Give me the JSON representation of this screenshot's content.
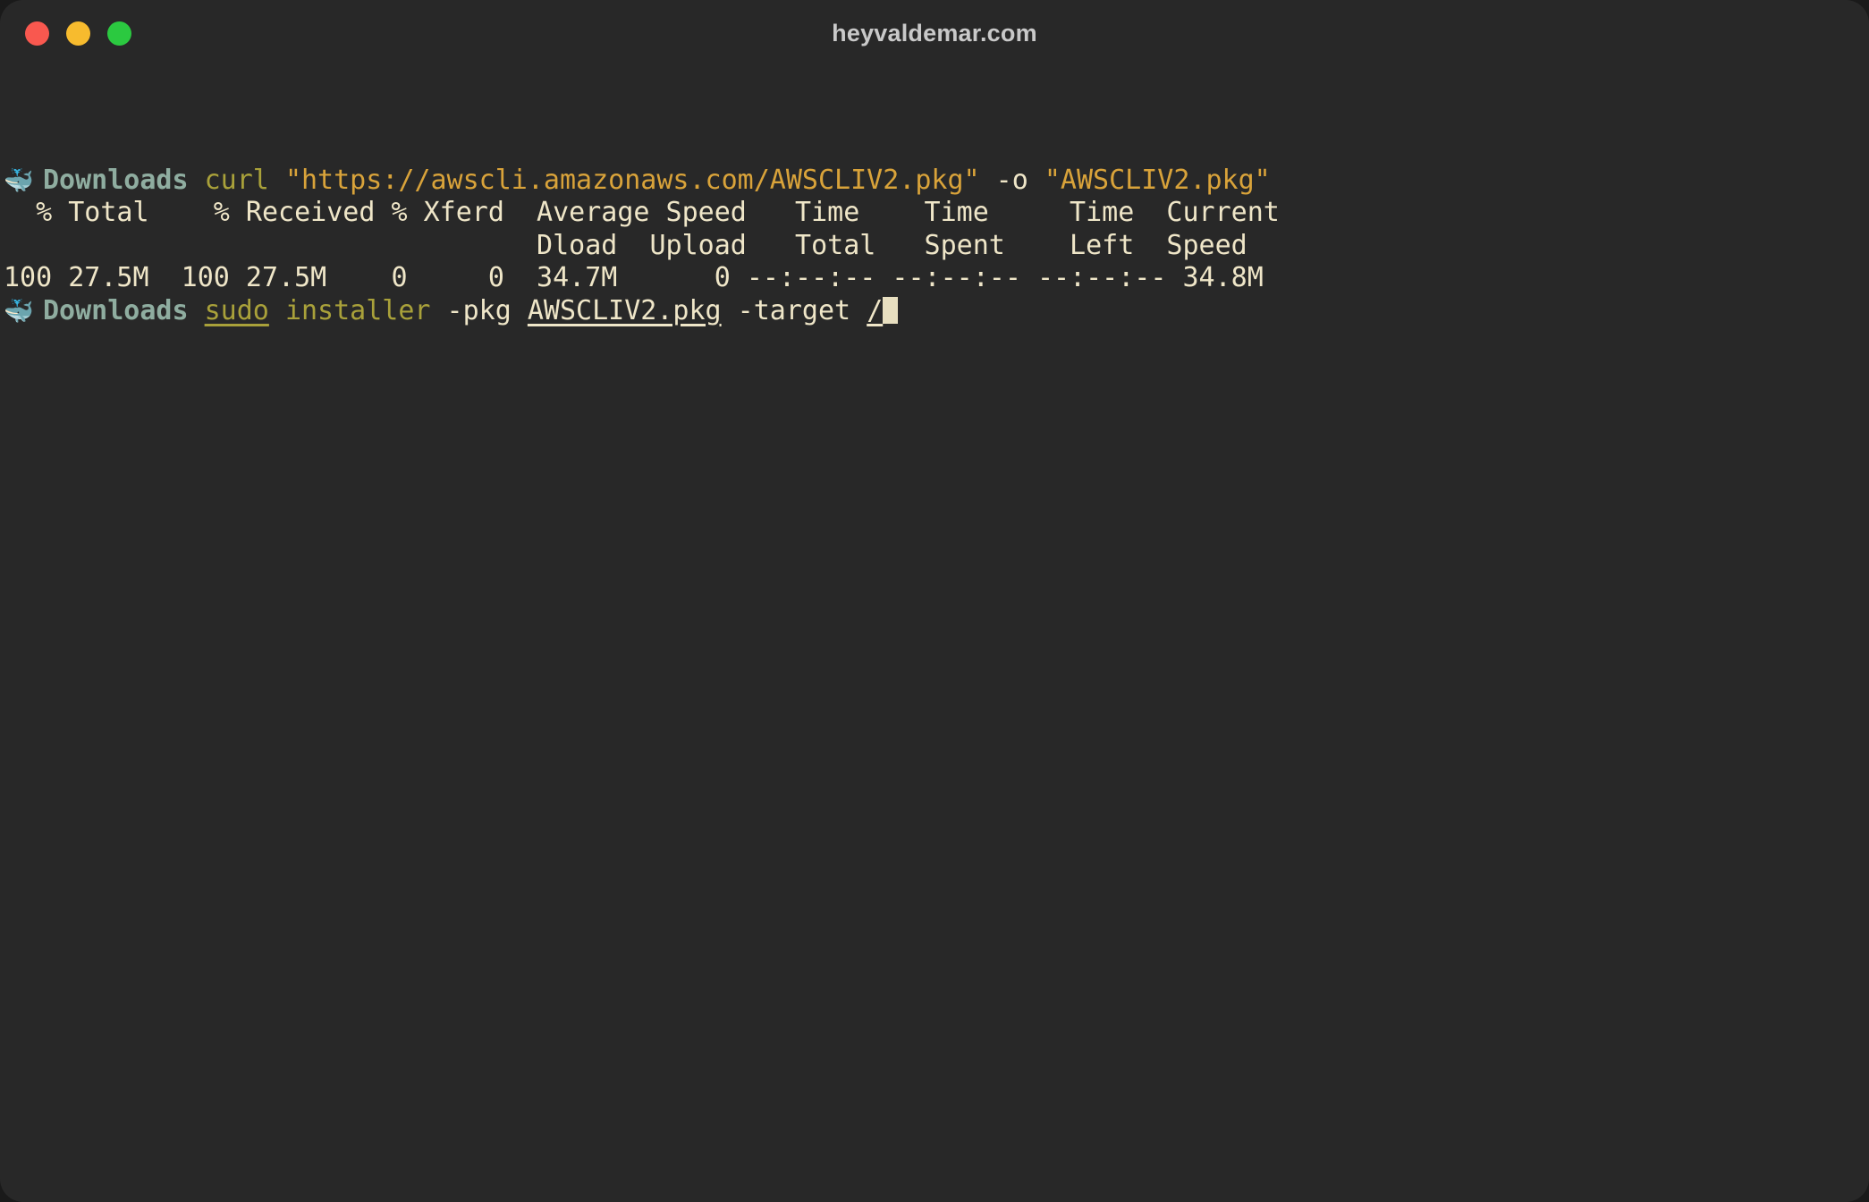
{
  "window": {
    "title": "heyvaldemar.com",
    "background": "#282828",
    "traffic_lights": [
      {
        "name": "close",
        "color": "#f9584f"
      },
      {
        "name": "minimize",
        "color": "#f7bb2e"
      },
      {
        "name": "maximize",
        "color": "#2bc940"
      }
    ]
  },
  "terminal": {
    "prompt_icon": "🐳",
    "prompt_path": "Downloads",
    "lines": [
      {
        "type": "prompt",
        "segments": [
          {
            "text": "curl ",
            "style": "cmd"
          },
          {
            "text": "\"https://awscli.amazonaws.com/AWSCLIV2.pkg\"",
            "style": "string"
          },
          {
            "text": " -o ",
            "style": "plain"
          },
          {
            "text": "\"AWSCLIV2.pkg\"",
            "style": "string"
          }
        ]
      },
      {
        "type": "output",
        "text": "  % Total    % Received % Xferd  Average Speed   Time    Time     Time  Current"
      },
      {
        "type": "output",
        "text": "                                 Dload  Upload   Total   Spent    Left  Speed"
      },
      {
        "type": "output",
        "text": "100 27.5M  100 27.5M    0     0  34.7M      0 --:--:-- --:--:-- --:--:-- 34.8M"
      },
      {
        "type": "prompt",
        "segments": [
          {
            "text": "sudo",
            "style": "cmd-u"
          },
          {
            "text": " ",
            "style": "plain"
          },
          {
            "text": "installer",
            "style": "cmd"
          },
          {
            "text": " -pkg ",
            "style": "plain"
          },
          {
            "text": "AWSCLIV2.pkg",
            "style": "plain-u"
          },
          {
            "text": " -target ",
            "style": "plain"
          },
          {
            "text": "/",
            "style": "plain-u"
          },
          {
            "text": "",
            "style": "cursor"
          }
        ]
      }
    ]
  },
  "colors": {
    "background": "#282828",
    "output_text": "#efe6c8",
    "path": "#8fada0",
    "command": "#a9a13a",
    "string": "#d9a33a",
    "cursor": "#e8dfc0"
  }
}
